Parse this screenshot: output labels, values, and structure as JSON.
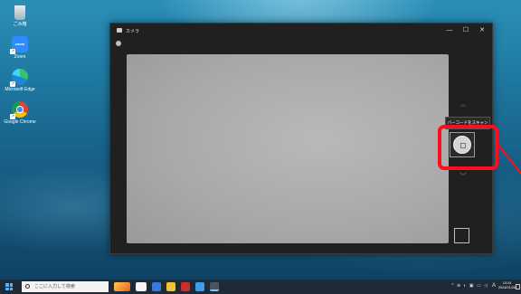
{
  "desktop": {
    "icons": [
      {
        "label": "ごみ箱",
        "icon": "recycle-bin-icon"
      },
      {
        "label": "Zoom",
        "icon": "zoom-icon"
      },
      {
        "label": "Microsoft Edge",
        "icon": "edge-icon"
      },
      {
        "label": "Google Chrome",
        "icon": "chrome-icon"
      }
    ]
  },
  "camera_window": {
    "title": "カメラ",
    "controls": {
      "minimize": "—",
      "maximize": "☐",
      "close": "✕"
    },
    "mode_up": "︿",
    "mode_down": "﹀",
    "tooltip": "バーコードをスキャン"
  },
  "annotation": {
    "color": "#ff0d1f"
  },
  "taskbar": {
    "search_placeholder": "ここに入力して検索",
    "tray_icons": "^ ⊕ ◐ ▣ ▭ ◁",
    "language": "A",
    "time": "10:24",
    "date": "2024/01/26"
  }
}
